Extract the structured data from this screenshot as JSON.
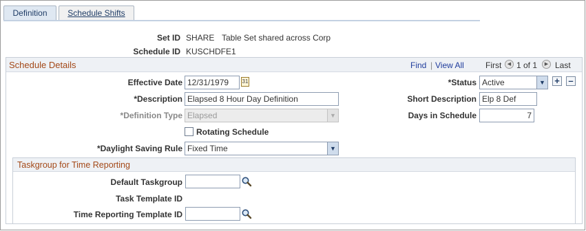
{
  "tabs": [
    {
      "label": "Definition",
      "active": true
    },
    {
      "label": "Schedule Shifts",
      "active": false
    }
  ],
  "header": {
    "setid_label": "Set ID",
    "setid_value": "SHARE",
    "setid_desc": "Table Set shared across Corp",
    "schedule_label": "Schedule ID",
    "schedule_value": "KUSCHDFE1"
  },
  "schedule_details": {
    "title": "Schedule Details",
    "nav": {
      "find": "Find",
      "view_all": "View All",
      "first": "First",
      "count": "1 of 1",
      "last": "Last"
    },
    "effective_date": {
      "label": "Effective Date",
      "value": "12/31/1979"
    },
    "status": {
      "label": "*Status",
      "value": "Active"
    },
    "description": {
      "label": "*Description",
      "value": "Elapsed 8 Hour Day Definition"
    },
    "short_description": {
      "label": "Short Description",
      "value": "Elp 8 Def"
    },
    "definition_type": {
      "label": "*Definition Type",
      "value": "Elapsed"
    },
    "days_in_schedule": {
      "label": "Days in Schedule",
      "value": "7"
    },
    "rotating_schedule": {
      "label": "Rotating Schedule",
      "checked": false
    },
    "daylight_saving_rule": {
      "label": "*Daylight Saving Rule",
      "value": "Fixed Time"
    }
  },
  "taskgroup": {
    "title": "Taskgroup for Time Reporting",
    "default_taskgroup": {
      "label": "Default Taskgroup",
      "value": ""
    },
    "task_template": {
      "label": "Task Template ID"
    },
    "time_reporting_template": {
      "label": "Time Reporting Template ID",
      "value": ""
    }
  },
  "icons": {
    "add": "plus-icon",
    "delete": "minus-icon",
    "calendar": "calendar-icon",
    "lookup": "magnifier-icon",
    "prev": "arrow-left-icon",
    "next": "arrow-right-icon"
  },
  "colors": {
    "section_title": "#a34817",
    "link": "#1f3c9c",
    "header_bg": "#eef1f5"
  }
}
